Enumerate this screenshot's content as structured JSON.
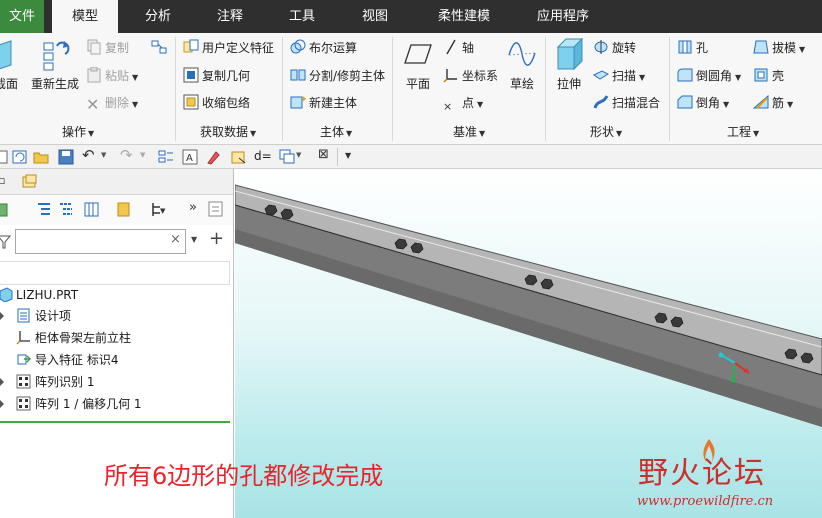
{
  "tabs": [
    {
      "label": "文件"
    },
    {
      "label": "模型"
    },
    {
      "label": "分析"
    },
    {
      "label": "注释"
    },
    {
      "label": "工具"
    },
    {
      "label": "视图"
    },
    {
      "label": "柔性建模"
    },
    {
      "label": "应用程序"
    }
  ],
  "ribbon": {
    "operations": {
      "label": "操作",
      "big_left": "截面",
      "regenerate": "重新生成",
      "copy": "复制",
      "paste": "粘贴",
      "delete": "删除"
    },
    "get_data": {
      "label": "获取数据",
      "udf": "用户定义特征",
      "copy_geom": "复制几何",
      "shrinkwrap": "收缩包络"
    },
    "body": {
      "label": "主体",
      "boolean": "布尔运算",
      "split": "分割/修剪主体",
      "new_body": "新建主体"
    },
    "datum": {
      "label": "基准",
      "plane": "平面",
      "axis": "轴",
      "csys": "坐标系",
      "point": "点",
      "sketch": "草绘"
    },
    "shapes": {
      "label": "形状",
      "extrude": "拉伸",
      "revolve": "旋转",
      "sweep": "扫描",
      "swept_blend": "扫描混合"
    },
    "engineering": {
      "label": "工程",
      "hole": "孔",
      "draft": "拔模",
      "round": "倒圆角",
      "shell": "壳",
      "chamfer": "倒角",
      "rib": "筋"
    }
  },
  "qat": {
    "d_eq": "d="
  },
  "panel": {
    "filter_value": ""
  },
  "tree": {
    "root": "LIZHU.PRT",
    "items": [
      {
        "label": "设计项"
      },
      {
        "label": "柜体骨架左前立柱"
      },
      {
        "label": "导入特征 标识4"
      },
      {
        "label": "阵列识别 1"
      },
      {
        "label": "阵列 1 / 偏移几何 1"
      }
    ]
  },
  "caption": "所有6边形的孔都修改完成",
  "watermark": {
    "title": "野火论坛",
    "url": "www.proewildfire.cn"
  },
  "colors": {
    "file_tab": "#3b8a3e",
    "tabbar": "#2f2f2f",
    "caption": "#e8232a",
    "watermark": "#c9302c",
    "viewport_bottom": "#a9e3e6"
  }
}
